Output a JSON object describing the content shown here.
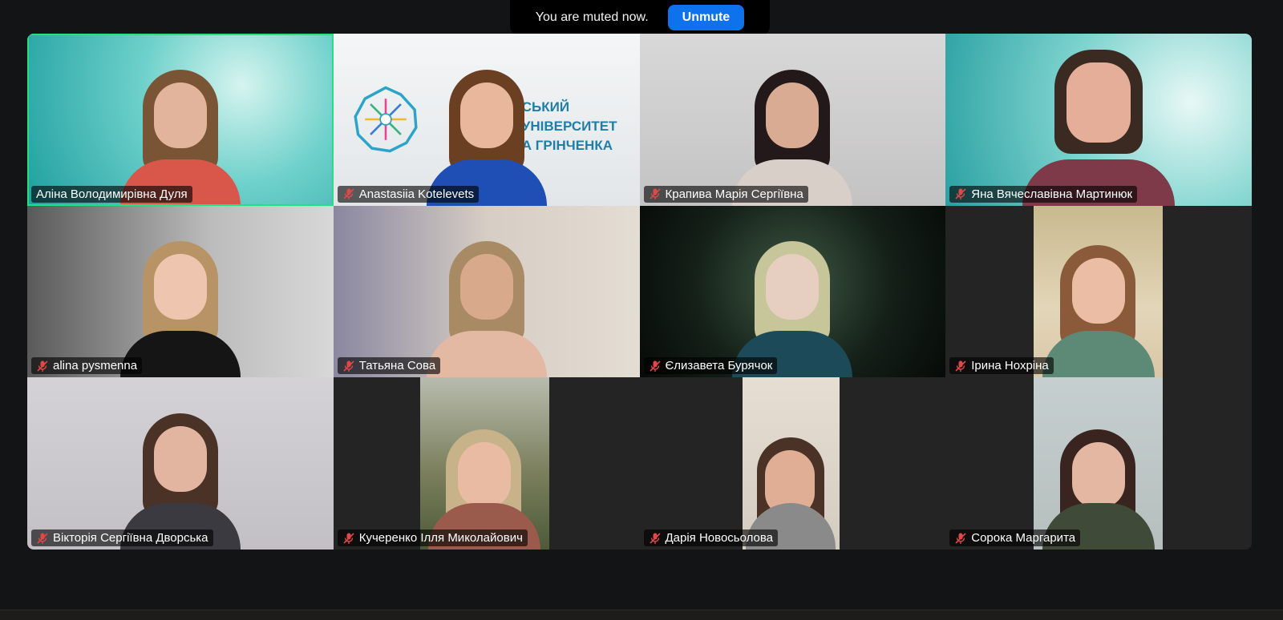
{
  "banner": {
    "message": "You are muted now.",
    "unmute_label": "Unmute"
  },
  "participants": [
    {
      "name": "Аліна Володимирівна Дуля",
      "muted": false,
      "active_speaker": true
    },
    {
      "name": "Anastasiia Kotelevets",
      "muted": true
    },
    {
      "name": "Крапива Марія Сергіївна",
      "muted": true
    },
    {
      "name": "Яна Вячеславівна Мартинюк",
      "muted": true
    },
    {
      "name": "alina pysmenna",
      "muted": true
    },
    {
      "name": "Татьяна Сова",
      "muted": true
    },
    {
      "name": "Єлизавета Бурячок",
      "muted": true
    },
    {
      "name": "Ірина Нохріна",
      "muted": true
    },
    {
      "name": "Вікторія Сергіївна Дворська",
      "muted": true
    },
    {
      "name": "Кучеренко Ілля Миколайович",
      "muted": true
    },
    {
      "name": "Дарія Новосьолова",
      "muted": true
    },
    {
      "name": "Сорока Маргарита",
      "muted": true
    }
  ],
  "background_logo_text": [
    "СЬКИЙ",
    "УНІВЕРСИТЕТ",
    "А ГРІНЧЕНКА"
  ],
  "colors": {
    "active_speaker_border": "#25e07d",
    "unmute_button": "#0e72ed",
    "muted_mic": "#e04848"
  },
  "icons": {
    "muted_mic": "microphone-muted-icon",
    "logo": "university-star-logo-icon"
  }
}
